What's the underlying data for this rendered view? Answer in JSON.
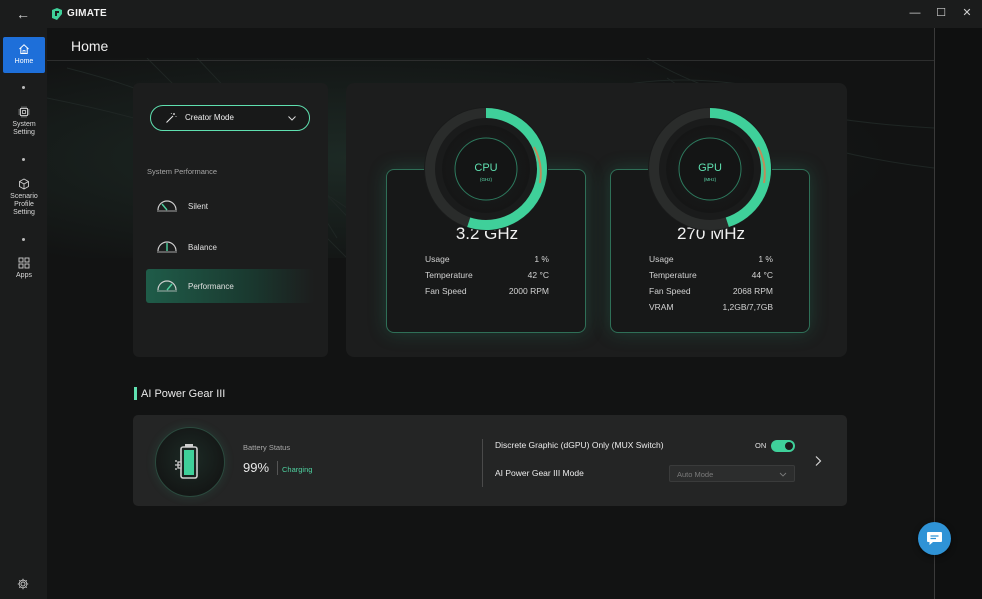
{
  "app": {
    "name": "GIMATE"
  },
  "window_controls": {
    "minimize": "—",
    "maximize": "☐",
    "close": "✕"
  },
  "sidebar": {
    "items": [
      {
        "label": "Home",
        "icon": "home-icon",
        "active": true
      },
      {
        "label": "System Setting",
        "icon": "chip-icon",
        "active": false
      },
      {
        "label": "Scenario Profile Setting",
        "icon": "cube-icon",
        "active": false
      },
      {
        "label": "Apps",
        "icon": "grid-icon",
        "active": false
      }
    ],
    "footer_icon": "settings-icon"
  },
  "page": {
    "title": "Home"
  },
  "mode_panel": {
    "selected_mode": "Creator Mode",
    "heading": "System Performance",
    "options": [
      {
        "label": "Silent",
        "active": false
      },
      {
        "label": "Balance",
        "active": false
      },
      {
        "label": "Performance",
        "active": true
      }
    ]
  },
  "cpu": {
    "name": "CPU",
    "unit": "(GHz)",
    "frequency": "3.2 GHz",
    "gauge_fraction": 0.55,
    "stats": [
      {
        "label": "Usage",
        "value": "1 %"
      },
      {
        "label": "Temperature",
        "value": "42 °C"
      },
      {
        "label": "Fan Speed",
        "value": "2000 RPM"
      }
    ]
  },
  "gpu": {
    "name": "GPU",
    "unit": "(MHz)",
    "frequency": "270 MHz",
    "gauge_fraction": 0.45,
    "stats": [
      {
        "label": "Usage",
        "value": "1 %"
      },
      {
        "label": "Temperature",
        "value": "44 °C"
      },
      {
        "label": "Fan Speed",
        "value": "2068 RPM"
      },
      {
        "label": "VRAM",
        "value": "1,2GB/7,7GB"
      }
    ]
  },
  "ai_power_gear": {
    "section_title": "AI Power Gear III",
    "battery_label": "Battery Status",
    "battery_percent": "99%",
    "battery_state": "Charging",
    "mux_label": "Discrete Graphic (dGPU) Only (MUX Switch)",
    "mux_state": "ON",
    "gear_mode_label": "AI Power Gear III Mode",
    "gear_mode_value": "Auto Mode"
  },
  "colors": {
    "accent": "#5fe0b0",
    "active_nav": "#1e6fd9",
    "chat_button": "#2f93d6",
    "charging": "#4fd1a0"
  }
}
